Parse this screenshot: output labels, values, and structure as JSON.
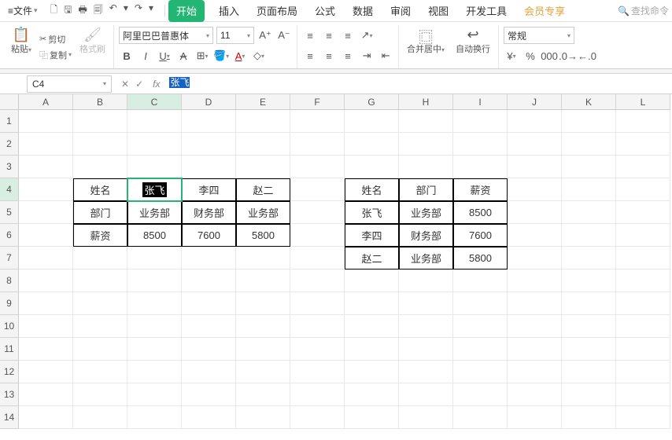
{
  "menubar": {
    "file": "文件",
    "tabs": [
      "开始",
      "插入",
      "页面布局",
      "公式",
      "数据",
      "审阅",
      "视图",
      "开发工具",
      "会员专享"
    ],
    "active_tab_index": 0,
    "search": "查找命令"
  },
  "ribbon": {
    "paste": "粘贴",
    "cut": "剪切",
    "copy": "复制",
    "format_painter": "格式刷",
    "font_name": "阿里巴巴普惠体",
    "font_size": "11",
    "merge_center": "合并居中",
    "auto_wrap": "自动换行",
    "number_format": "常规"
  },
  "namebox": {
    "cell_ref": "C4",
    "formula_text": "张飞"
  },
  "grid": {
    "cols": [
      "A",
      "B",
      "C",
      "D",
      "E",
      "F",
      "G",
      "H",
      "I",
      "J",
      "K",
      "L"
    ],
    "selected_col_index": 2,
    "selected_row": 4,
    "row_count": 14
  },
  "table1": {
    "r4": {
      "B": "姓名",
      "C": "张飞",
      "D": "李四",
      "E": "赵二"
    },
    "r5": {
      "B": "部门",
      "C": "业务部",
      "D": "财务部",
      "E": "业务部"
    },
    "r6": {
      "B": "薪资",
      "C": "8500",
      "D": "7600",
      "E": "5800"
    }
  },
  "table2": {
    "r4": {
      "G": "姓名",
      "H": "部门",
      "I": "薪资"
    },
    "r5": {
      "G": "张飞",
      "H": "业务部",
      "I": "8500"
    },
    "r6": {
      "G": "李四",
      "H": "财务部",
      "I": "7600"
    },
    "r7": {
      "G": "赵二",
      "H": "业务部",
      "I": "5800"
    }
  },
  "chart_data": {
    "type": "table",
    "table1": {
      "headers_row": [
        "姓名",
        "张飞",
        "李四",
        "赵二"
      ],
      "rows": [
        [
          "部门",
          "业务部",
          "财务部",
          "业务部"
        ],
        [
          "薪资",
          8500,
          7600,
          5800
        ]
      ]
    },
    "table2": {
      "headers": [
        "姓名",
        "部门",
        "薪资"
      ],
      "rows": [
        [
          "张飞",
          "业务部",
          8500
        ],
        [
          "李四",
          "财务部",
          7600
        ],
        [
          "赵二",
          "业务部",
          5800
        ]
      ]
    }
  }
}
